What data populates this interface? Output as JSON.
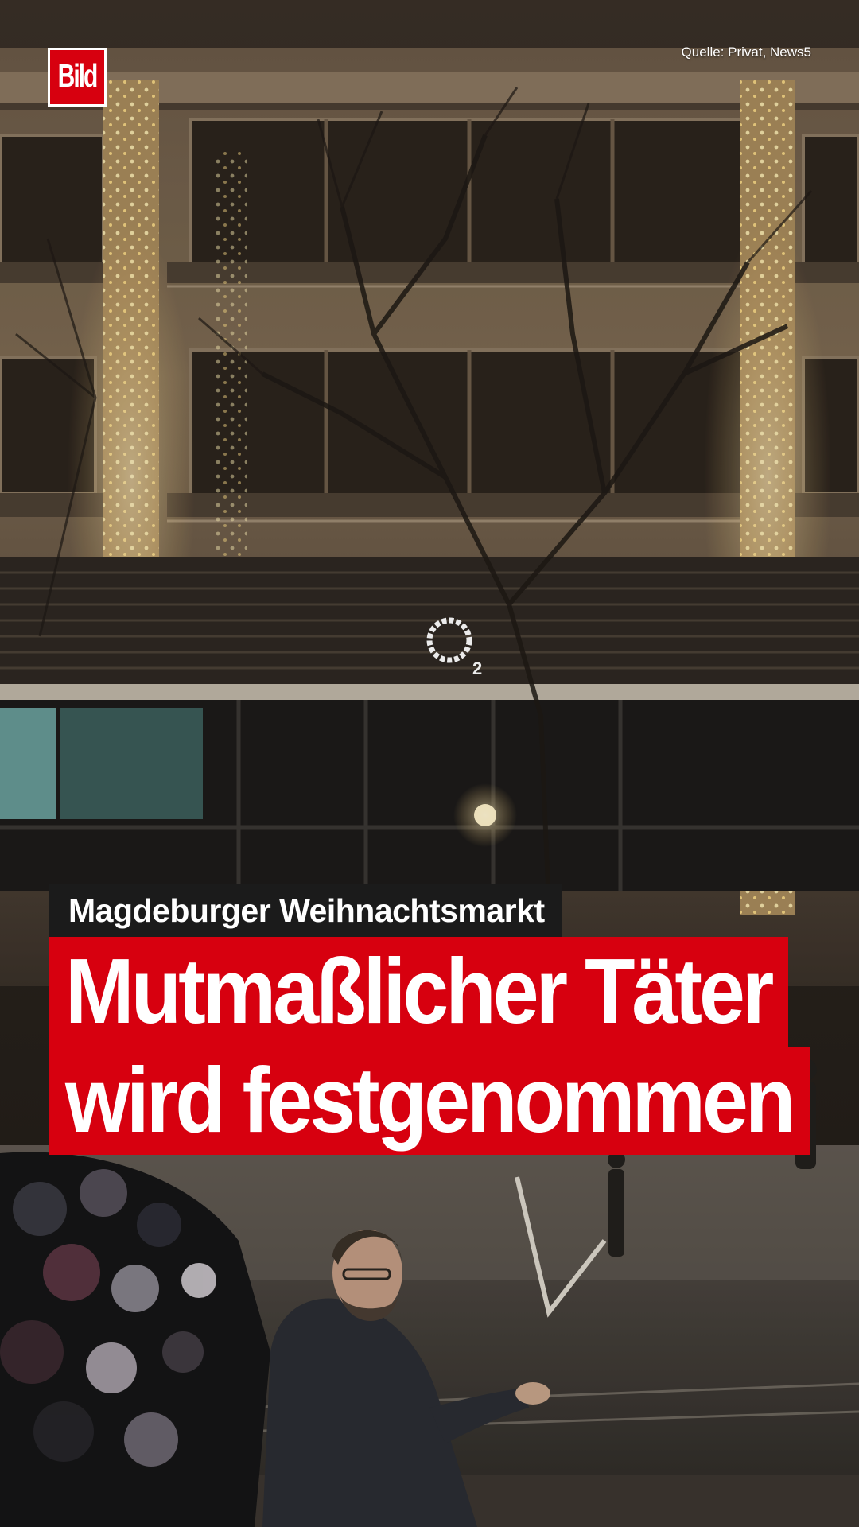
{
  "brand": {
    "logo_text": "Bild",
    "color": "#d7000f"
  },
  "source_credit": "Quelle: Privat, News5",
  "kicker": "Magdeburger Weihnachtsmarkt",
  "headline": {
    "line1": "Mutmaßlicher Täter",
    "line2": "wird festgenommen"
  },
  "photo": {
    "storefront_sign": "O2"
  }
}
